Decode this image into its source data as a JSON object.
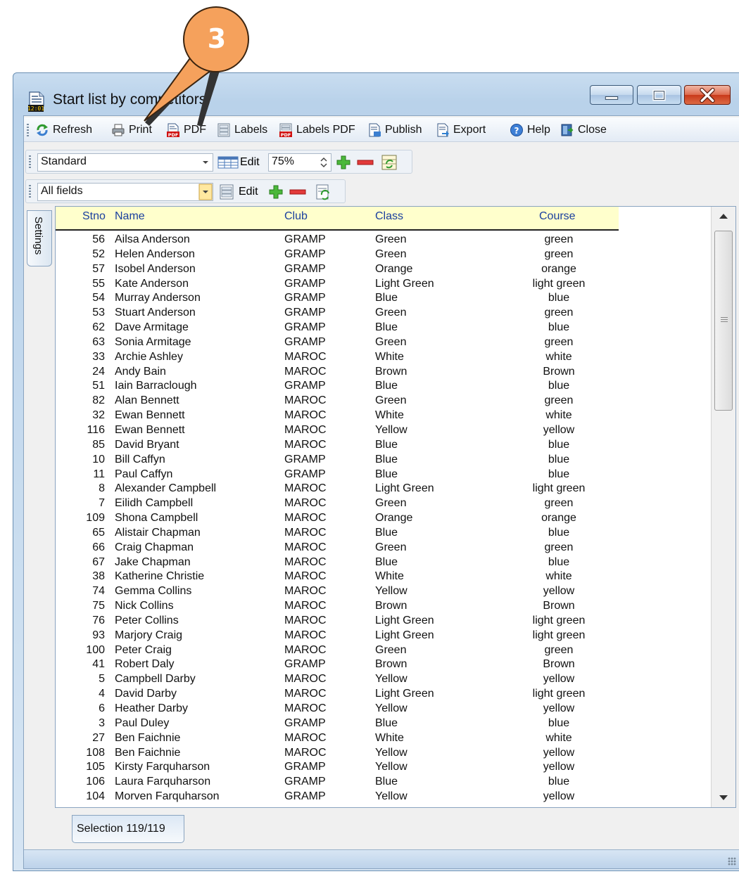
{
  "window": {
    "title": "Start list by competitors"
  },
  "callout": {
    "number": "3",
    "color": "#f5a15c"
  },
  "toolbar": {
    "refresh": "Refresh",
    "print": "Print",
    "pdf": "PDF",
    "labels": "Labels",
    "labels_pdf": "Labels PDF",
    "publish": "Publish",
    "export": "Export",
    "help": "Help",
    "close": "Close"
  },
  "layout_bar": {
    "selected": "Standard",
    "edit": "Edit",
    "zoom": "75%"
  },
  "fields_bar": {
    "selected": "All fields",
    "edit": "Edit"
  },
  "side_tab": {
    "label": "Settings"
  },
  "table": {
    "columns": [
      "Stno",
      "Name",
      "Club",
      "Class",
      "Course"
    ],
    "rows": [
      [
        "56",
        "Ailsa Anderson",
        "GRAMP",
        "Green",
        "green"
      ],
      [
        "52",
        "Helen Anderson",
        "GRAMP",
        "Green",
        "green"
      ],
      [
        "57",
        "Isobel Anderson",
        "GRAMP",
        "Orange",
        "orange"
      ],
      [
        "55",
        "Kate Anderson",
        "GRAMP",
        "Light Green",
        "light green"
      ],
      [
        "54",
        "Murray Anderson",
        "GRAMP",
        "Blue",
        "blue"
      ],
      [
        "53",
        "Stuart Anderson",
        "GRAMP",
        "Green",
        "green"
      ],
      [
        "62",
        "Dave Armitage",
        "GRAMP",
        "Blue",
        "blue"
      ],
      [
        "63",
        "Sonia Armitage",
        "GRAMP",
        "Green",
        "green"
      ],
      [
        "33",
        "Archie Ashley",
        "MAROC",
        "White",
        "white"
      ],
      [
        "24",
        "Andy Bain",
        "MAROC",
        "Brown",
        "Brown"
      ],
      [
        "51",
        "Iain Barraclough",
        "GRAMP",
        "Blue",
        "blue"
      ],
      [
        "82",
        "Alan Bennett",
        "MAROC",
        "Green",
        "green"
      ],
      [
        "32",
        "Ewan Bennett",
        "MAROC",
        "White",
        "white"
      ],
      [
        "116",
        "Ewan Bennett",
        "MAROC",
        "Yellow",
        "yellow"
      ],
      [
        "85",
        "David Bryant",
        "MAROC",
        "Blue",
        "blue"
      ],
      [
        "10",
        "Bill Caffyn",
        "GRAMP",
        "Blue",
        "blue"
      ],
      [
        "11",
        "Paul Caffyn",
        "GRAMP",
        "Blue",
        "blue"
      ],
      [
        "8",
        "Alexander Campbell",
        "MAROC",
        "Light Green",
        "light green"
      ],
      [
        "7",
        "Eilidh Campbell",
        "MAROC",
        "Green",
        "green"
      ],
      [
        "109",
        "Shona Campbell",
        "MAROC",
        "Orange",
        "orange"
      ],
      [
        "65",
        "Alistair Chapman",
        "MAROC",
        "Blue",
        "blue"
      ],
      [
        "66",
        "Craig Chapman",
        "MAROC",
        "Green",
        "green"
      ],
      [
        "67",
        "Jake Chapman",
        "MAROC",
        "Blue",
        "blue"
      ],
      [
        "38",
        "Katherine Christie",
        "MAROC",
        "White",
        "white"
      ],
      [
        "74",
        "Gemma Collins",
        "MAROC",
        "Yellow",
        "yellow"
      ],
      [
        "75",
        "Nick Collins",
        "MAROC",
        "Brown",
        "Brown"
      ],
      [
        "76",
        "Peter Collins",
        "MAROC",
        "Light Green",
        "light green"
      ],
      [
        "93",
        "Marjory Craig",
        "MAROC",
        "Light Green",
        "light green"
      ],
      [
        "100",
        "Peter Craig",
        "MAROC",
        "Green",
        "green"
      ],
      [
        "41",
        "Robert Daly",
        "GRAMP",
        "Brown",
        "Brown"
      ],
      [
        "5",
        "Campbell Darby",
        "MAROC",
        "Yellow",
        "yellow"
      ],
      [
        "4",
        "David Darby",
        "MAROC",
        "Light Green",
        "light green"
      ],
      [
        "6",
        "Heather Darby",
        "MAROC",
        "Yellow",
        "yellow"
      ],
      [
        "3",
        "Paul Duley",
        "GRAMP",
        "Blue",
        "blue"
      ],
      [
        "27",
        "Ben Faichnie",
        "MAROC",
        "White",
        "white"
      ],
      [
        "108",
        "Ben Faichnie",
        "MAROC",
        "Yellow",
        "yellow"
      ],
      [
        "105",
        "Kirsty Farquharson",
        "GRAMP",
        "Yellow",
        "yellow"
      ],
      [
        "106",
        "Laura Farquharson",
        "GRAMP",
        "Blue",
        "blue"
      ],
      [
        "104",
        "Morven Farquharson",
        "GRAMP",
        "Yellow",
        "yellow"
      ]
    ]
  },
  "status": {
    "selection": "Selection  119/119"
  }
}
